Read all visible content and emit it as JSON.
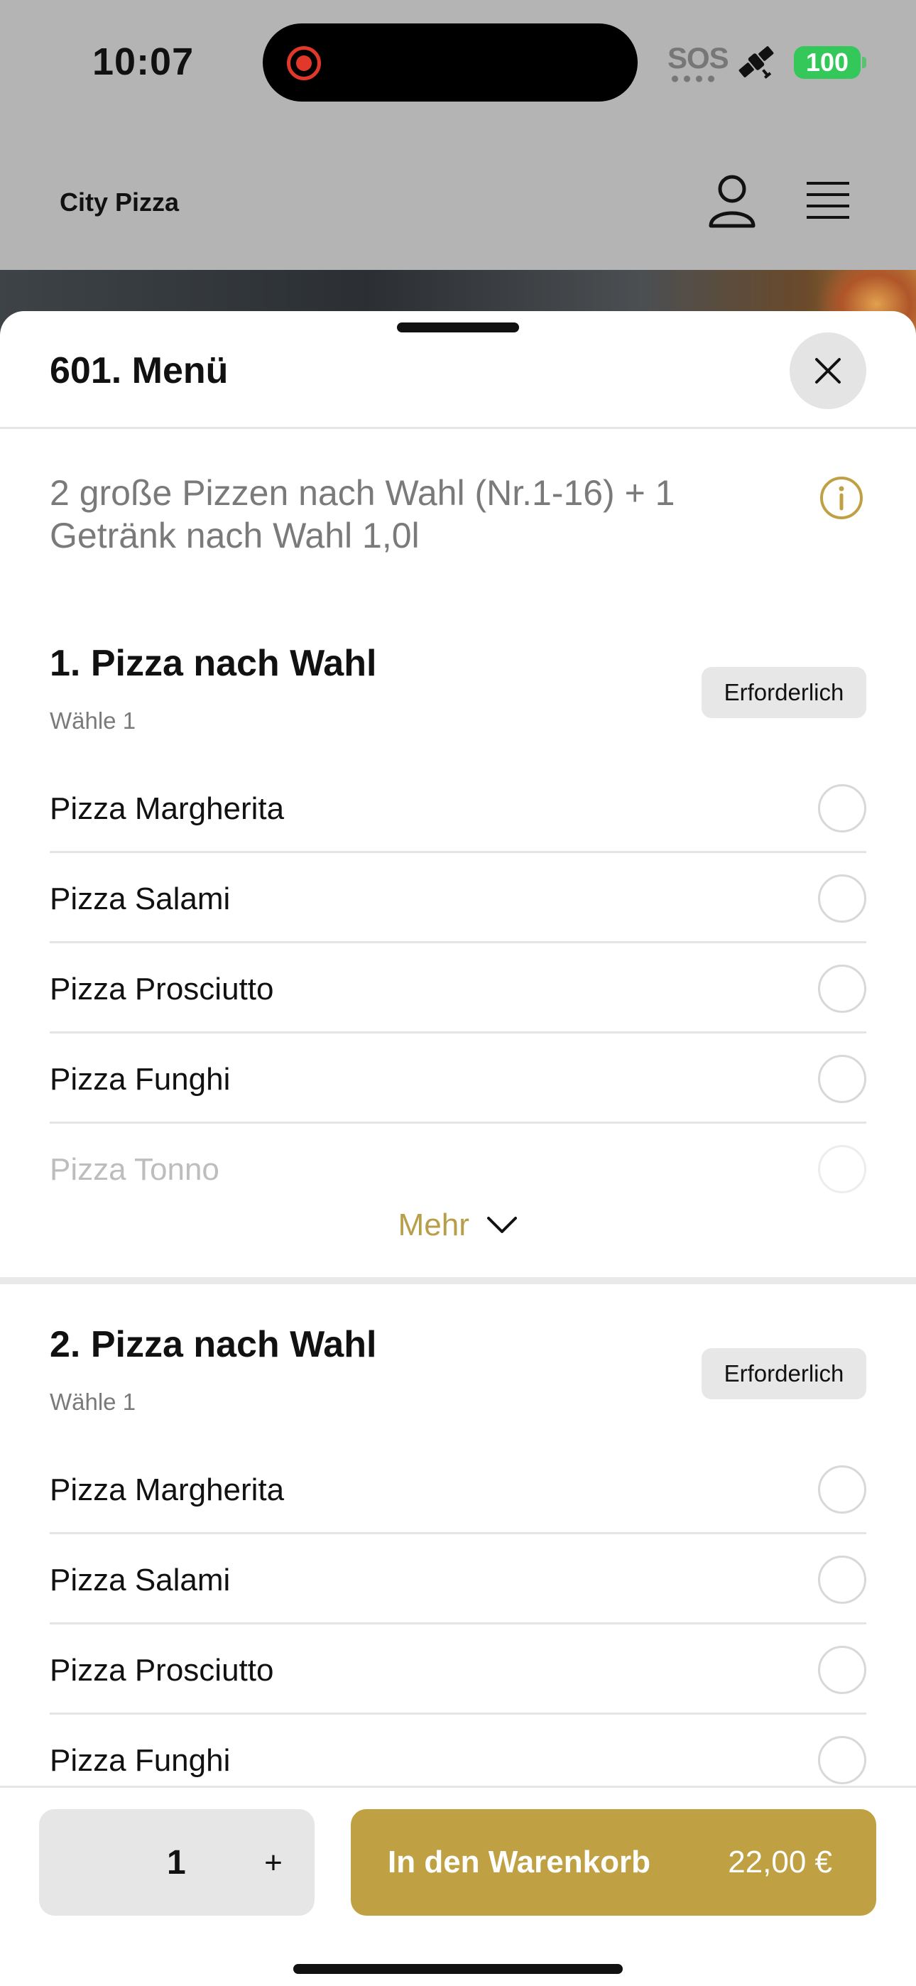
{
  "status": {
    "time": "10:07",
    "sos": "SOS",
    "battery": "100",
    "colors": {
      "battery": "#34c759",
      "recording": "#e2382b"
    }
  },
  "header": {
    "brand": "City Pizza",
    "icons": [
      "user-icon",
      "menu-icon"
    ]
  },
  "sheet": {
    "title": "601. Menü",
    "description": "2 große Pizzen nach Wahl (Nr.1-16) + 1 Getränk nach Wahl 1,0l",
    "accent_color": "#bfa043"
  },
  "groups": [
    {
      "title": "1. Pizza nach Wahl",
      "subtitle": "Wähle 1",
      "badge": "Erforderlich",
      "options": [
        {
          "label": "Pizza Margherita"
        },
        {
          "label": "Pizza Salami"
        },
        {
          "label": "Pizza Prosciutto"
        },
        {
          "label": "Pizza Funghi"
        },
        {
          "label": "Pizza Tonno"
        }
      ],
      "more_label": "Mehr"
    },
    {
      "title": "2. Pizza nach Wahl",
      "subtitle": "Wähle 1",
      "badge": "Erforderlich",
      "options": [
        {
          "label": "Pizza Margherita"
        },
        {
          "label": "Pizza Salami"
        },
        {
          "label": "Pizza Prosciutto"
        },
        {
          "label": "Pizza Funghi"
        }
      ]
    }
  ],
  "footer": {
    "quantity": "1",
    "plus": "+",
    "cart_label": "In den Warenkorb",
    "price": "22,00 €"
  }
}
